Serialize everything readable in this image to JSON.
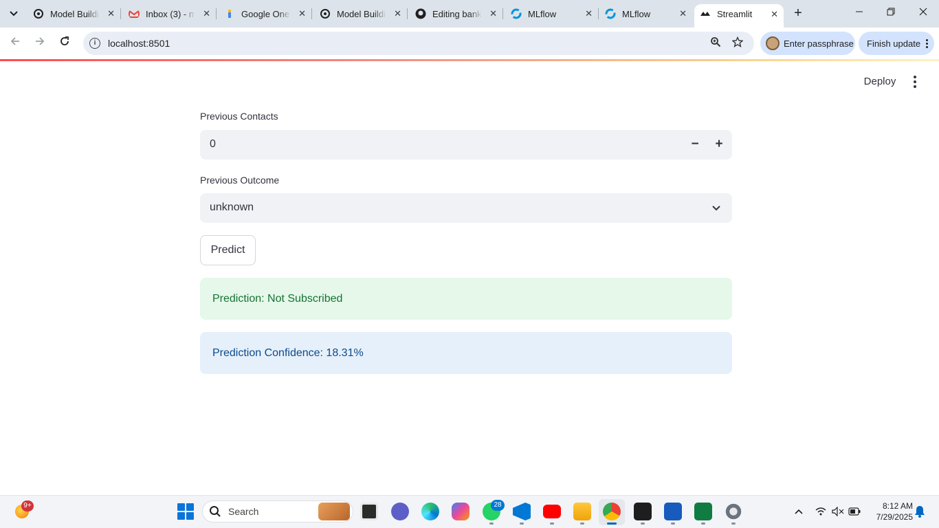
{
  "browser": {
    "tabs": [
      {
        "title": "Model Buildi",
        "favicon": "openai-icon",
        "color": "#1f1f1f"
      },
      {
        "title": "Inbox (3) - m",
        "favicon": "gmail-icon",
        "color": "#ea4335"
      },
      {
        "title": "Google One",
        "favicon": "google-one-icon",
        "color": "#4285f4"
      },
      {
        "title": "Model Buildi",
        "favicon": "openai-icon",
        "color": "#1f1f1f"
      },
      {
        "title": "Editing bank",
        "favicon": "github-icon",
        "color": "#1f1f1f"
      },
      {
        "title": "MLflow",
        "favicon": "mlflow-icon",
        "color": "#0194e2"
      },
      {
        "title": "MLflow",
        "favicon": "mlflow-icon",
        "color": "#0194e2"
      },
      {
        "title": "Streamlit",
        "favicon": "streamlit-icon",
        "color": "#1f1f1f",
        "active": true
      }
    ],
    "url": "localhost:8501",
    "passphrase_label": "Enter passphrase",
    "update_label": "Finish update"
  },
  "app": {
    "deploy_label": "Deploy",
    "previous_contacts": {
      "label": "Previous Contacts",
      "value": "0",
      "decrement": "−",
      "increment": "+"
    },
    "previous_outcome": {
      "label": "Previous Outcome",
      "value": "unknown"
    },
    "predict_label": "Predict",
    "prediction_text": "Prediction: Not Subscribed",
    "confidence_text": "Prediction Confidence: 18.31%"
  },
  "taskbar": {
    "search_placeholder": "Search",
    "widget_badge": "9+",
    "whatsapp_badge": "28",
    "time": "8:12 AM",
    "date": "7/29/2025"
  },
  "colors": {
    "streamlit_accent": "#ff4b4b",
    "success_bg": "#e5f8ea",
    "success_text": "#177233",
    "info_bg": "#e6f0fb",
    "info_text": "#0c4a8a"
  }
}
